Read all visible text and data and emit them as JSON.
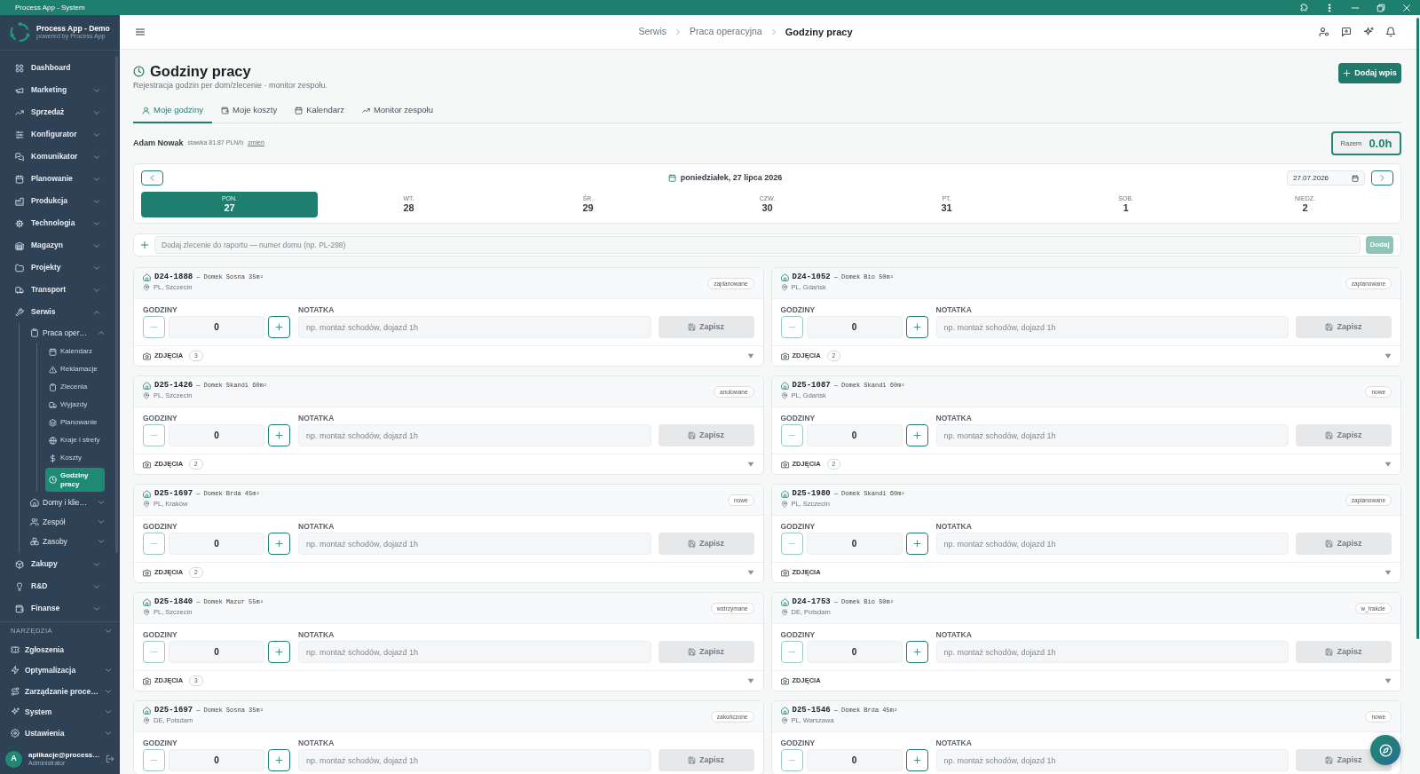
{
  "window": {
    "title": "Process App - System"
  },
  "sidebar": {
    "brand": {
      "name": "Process App - Demo",
      "tagline": "powered by Process App"
    },
    "items": [
      {
        "label": "Dashboard",
        "kind": "link",
        "selected": false
      },
      {
        "label": "Marketing",
        "kind": "group",
        "expanded": false,
        "selected": false
      },
      {
        "label": "Sprzedaż",
        "kind": "group",
        "expanded": false,
        "selected": false
      },
      {
        "label": "Konfigurator",
        "kind": "group",
        "expanded": false,
        "selected": false
      },
      {
        "label": "Komunikator",
        "kind": "group",
        "expanded": false,
        "selected": false
      },
      {
        "label": "Planowanie",
        "kind": "group",
        "expanded": false,
        "selected": false
      },
      {
        "label": "Produkcja",
        "kind": "group",
        "expanded": false,
        "selected": false
      },
      {
        "label": "Technologia",
        "kind": "group",
        "expanded": false,
        "selected": false
      },
      {
        "label": "Magazyn",
        "kind": "group",
        "expanded": false,
        "selected": false
      },
      {
        "label": "Projekty",
        "kind": "group",
        "expanded": false,
        "selected": false
      },
      {
        "label": "Transport",
        "kind": "group",
        "expanded": false,
        "selected": false
      },
      {
        "label": "Serwis",
        "kind": "group",
        "expanded": true,
        "selected": false,
        "children": [
          {
            "label": "Praca oper…",
            "kind": "group",
            "expanded": true,
            "selected": false,
            "children": [
              {
                "label": "Kalendarz",
                "kind": "link",
                "selected": false
              },
              {
                "label": "Reklamacje",
                "kind": "link",
                "selected": false
              },
              {
                "label": "Zlecenia",
                "kind": "link",
                "selected": false
              },
              {
                "label": "Wyjazdy",
                "kind": "link",
                "selected": false
              },
              {
                "label": "Planowanie",
                "kind": "link",
                "selected": false
              },
              {
                "label": "Kraje i strefy",
                "kind": "link",
                "selected": false
              },
              {
                "label": "Koszty",
                "kind": "link",
                "selected": false
              },
              {
                "label": "Godziny pracy",
                "kind": "link",
                "selected": true
              }
            ]
          },
          {
            "label": "Domy i klie…",
            "kind": "group",
            "expanded": false,
            "selected": false
          },
          {
            "label": "Zespół",
            "kind": "group",
            "expanded": false,
            "selected": false
          },
          {
            "label": "Zasoby",
            "kind": "group",
            "expanded": false,
            "selected": false
          }
        ]
      },
      {
        "label": "Zakupy",
        "kind": "group",
        "expanded": false,
        "selected": false
      },
      {
        "label": "R&D",
        "kind": "group",
        "expanded": false,
        "selected": false
      },
      {
        "label": "Finanse",
        "kind": "group",
        "expanded": false,
        "selected": false
      }
    ],
    "tools": {
      "title": "NARZĘDZIA",
      "items": [
        {
          "label": "Zgłoszenia",
          "kind": "link",
          "selected": false
        },
        {
          "label": "Optymalizacja",
          "kind": "group",
          "expanded": false,
          "selected": false
        },
        {
          "label": "Zarządzanie proce…",
          "kind": "group",
          "expanded": false,
          "selected": false
        },
        {
          "label": "System",
          "kind": "group",
          "expanded": false,
          "selected": false
        },
        {
          "label": "Ustawienia",
          "kind": "group",
          "expanded": false,
          "selected": false
        }
      ]
    },
    "user": {
      "initial": "A",
      "email": "aplikacje@process…",
      "role": "Administrator"
    }
  },
  "header": {
    "breadcrumbs": [
      {
        "label": "Serwis",
        "current": false
      },
      {
        "label": "Praca operacyjna",
        "current": false
      },
      {
        "label": "Godziny pracy",
        "current": true
      }
    ]
  },
  "page": {
    "title": "Godziny pracy",
    "subtitle": "Rejestracja godzin per dom/zlecenie · monitor zespołu.",
    "add_button": "Dodaj wpis"
  },
  "tabs": [
    {
      "label": "Moje godziny",
      "selected": true
    },
    {
      "label": "Moje koszty",
      "selected": false
    },
    {
      "label": "Kalendarz",
      "selected": false
    },
    {
      "label": "Monitor zespołu",
      "selected": false
    }
  ],
  "worker": {
    "name": "Adam Nowak",
    "rate": "stawka 81.87 PLN/h",
    "change_link": "zmień"
  },
  "total": {
    "label": "Razem",
    "value": "0.0h"
  },
  "week": {
    "title": "poniedziałek, 27 lipca 2026",
    "date": "27.07.2026",
    "days": [
      {
        "label": "PON.",
        "number": "27",
        "selected": true
      },
      {
        "label": "WT.",
        "number": "28",
        "selected": false
      },
      {
        "label": "ŚR.",
        "number": "29",
        "selected": false
      },
      {
        "label": "CZW.",
        "number": "30",
        "selected": false
      },
      {
        "label": "PT.",
        "number": "31",
        "selected": false
      },
      {
        "label": "SOB.",
        "number": "1",
        "selected": false
      },
      {
        "label": "NIEDZ.",
        "number": "2",
        "selected": false
      }
    ]
  },
  "add_order": {
    "placeholder": "Dodaj zlecenie do raportu — numer domu (np. PL-298)",
    "button": "Dodaj",
    "disabled": true
  },
  "orders": [
    {
      "code": "D24-1888",
      "house": "— Domek Sosna 35m²",
      "location": "PL, Szczecin",
      "status": "zaplanowane",
      "hours_label": "GODZINY",
      "hours": "0",
      "minus_disabled": true,
      "note_label": "NOTATKA",
      "note_placeholder": "np. montaż schodów, dojazd 1h",
      "save": "Zapisz",
      "save_disabled": true,
      "photos": {
        "label": "ZDJĘCIA",
        "count": "3"
      }
    },
    {
      "code": "D24-1052",
      "house": "— Domek Bio 50m²",
      "location": "PL, Gdańsk",
      "status": "zaplanowane",
      "hours_label": "GODZINY",
      "hours": "0",
      "minus_disabled": true,
      "note_label": "NOTATKA",
      "note_placeholder": "np. montaż schodów, dojazd 1h",
      "save": "Zapisz",
      "save_disabled": true,
      "photos": {
        "label": "ZDJĘCIA",
        "count": "2"
      }
    },
    {
      "code": "D25-1426",
      "house": "— Domek Skandi 60m²",
      "location": "PL, Szczecin",
      "status": "anulowane",
      "hours_label": "GODZINY",
      "hours": "0",
      "minus_disabled": true,
      "note_label": "NOTATKA",
      "note_placeholder": "np. montaż schodów, dojazd 1h",
      "save": "Zapisz",
      "save_disabled": true,
      "photos": {
        "label": "ZDJĘCIA",
        "count": "2"
      }
    },
    {
      "code": "D25-1087",
      "house": "— Domek Skandi 60m²",
      "location": "PL, Gdańsk",
      "status": "nowe",
      "hours_label": "GODZINY",
      "hours": "0",
      "minus_disabled": true,
      "note_label": "NOTATKA",
      "note_placeholder": "np. montaż schodów, dojazd 1h",
      "save": "Zapisz",
      "save_disabled": true,
      "photos": {
        "label": "ZDJĘCIA",
        "count": "2"
      }
    },
    {
      "code": "D25-1697",
      "house": "— Domek Brda 45m²",
      "location": "PL, Kraków",
      "status": "nowe",
      "hours_label": "GODZINY",
      "hours": "0",
      "minus_disabled": true,
      "note_label": "NOTATKA",
      "note_placeholder": "np. montaż schodów, dojazd 1h",
      "save": "Zapisz",
      "save_disabled": true,
      "photos": {
        "label": "ZDJĘCIA",
        "count": "2"
      }
    },
    {
      "code": "D25-1980",
      "house": "— Domek Skandi 60m²",
      "location": "PL, Szczecin",
      "status": "zaplanowane",
      "hours_label": "GODZINY",
      "hours": "0",
      "minus_disabled": true,
      "note_label": "NOTATKA",
      "note_placeholder": "np. montaż schodów, dojazd 1h",
      "save": "Zapisz",
      "save_disabled": true,
      "photos": {
        "label": "ZDJĘCIA"
      }
    },
    {
      "code": "D25-1840",
      "house": "— Domek Mazur 55m²",
      "location": "PL, Szczecin",
      "status": "wstrzymane",
      "hours_label": "GODZINY",
      "hours": "0",
      "minus_disabled": true,
      "note_label": "NOTATKA",
      "note_placeholder": "np. montaż schodów, dojazd 1h",
      "save": "Zapisz",
      "save_disabled": true,
      "photos": {
        "label": "ZDJĘCIA",
        "count": "3"
      }
    },
    {
      "code": "D24-1753",
      "house": "— Domek Bio 50m²",
      "location": "DE, Potsdam",
      "status": "w_trakcie",
      "hours_label": "GODZINY",
      "hours": "0",
      "minus_disabled": true,
      "note_label": "NOTATKA",
      "note_placeholder": "np. montaż schodów, dojazd 1h",
      "save": "Zapisz",
      "save_disabled": true,
      "photos": {
        "label": "ZDJĘCIA"
      }
    },
    {
      "code": "D25-1697",
      "house": "— Domek Sosna 35m²",
      "location": "DE, Potsdam",
      "status": "zakończone",
      "hours_label": "GODZINY",
      "hours": "0",
      "minus_disabled": true,
      "note_label": "NOTATKA",
      "note_placeholder": "np. montaż schodów, dojazd 1h",
      "save": "Zapisz",
      "save_disabled": true
    },
    {
      "code": "D25-1546",
      "house": "— Domek Brda 45m²",
      "location": "PL, Warszawa",
      "status": "nowe",
      "hours_label": "GODZINY",
      "hours": "0",
      "minus_disabled": true,
      "note_label": "NOTATKA",
      "note_placeholder": "np. montaż schodów, dojazd 1h",
      "save": "Zapisz",
      "save_disabled": true
    }
  ]
}
